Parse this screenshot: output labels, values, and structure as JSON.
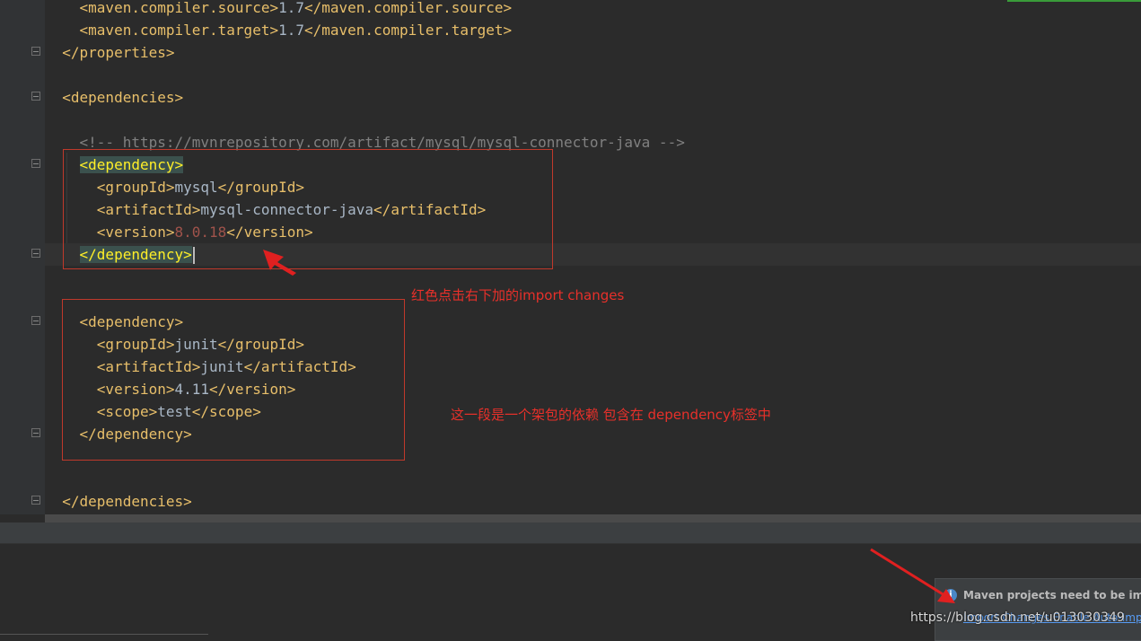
{
  "editor": {
    "lines": [
      {
        "open": "<maven.compiler.source>",
        "text": "1.7",
        "close": "</maven.compiler.source>"
      },
      {
        "open": "<maven.compiler.target>",
        "text": "1.7",
        "close": "</maven.compiler.target>"
      },
      {
        "tag": "</properties>"
      },
      {
        "tag": "<dependencies>"
      },
      {
        "comment": "<!-- https://mvnrepository.com/artifact/mysql/mysql-connector-java -->"
      },
      {
        "tag": "<dependency>"
      },
      {
        "open": "<groupId>",
        "text": "mysql",
        "close": "</groupId>"
      },
      {
        "open": "<artifactId>",
        "text": "mysql-connector-java",
        "close": "</artifactId>"
      },
      {
        "open": "<version>",
        "text": "8.0.18",
        "close": "</version>"
      },
      {
        "tag": "</dependency>"
      },
      {
        "tag": "<dependency>"
      },
      {
        "open": "<groupId>",
        "text": "junit",
        "close": "</groupId>"
      },
      {
        "open": "<artifactId>",
        "text": "junit",
        "close": "</artifactId>"
      },
      {
        "open": "<version>",
        "text": "4.11",
        "close": "</version>"
      },
      {
        "open": "<scope>",
        "text": "test",
        "close": "</scope>"
      },
      {
        "tag": "</dependency>"
      },
      {
        "tag": "</dependencies>"
      }
    ]
  },
  "annotations": {
    "note1": "红色点击右下加的import changes",
    "note2": "这一段是一个架包的依赖 包含在 dependency标签中"
  },
  "notification": {
    "icon": "info-icon",
    "title": "Maven projects need to be impo",
    "link": "Import Changes    Enable Auto-Imp"
  },
  "watermark": "https://blog.csdn.net/u013030349",
  "colors": {
    "tag": "#e8bf6a",
    "text": "#a9b7c6",
    "number": "#a0534b",
    "comment": "#808080",
    "annotation_red": "#e8302a",
    "background": "#2b2b2b"
  }
}
